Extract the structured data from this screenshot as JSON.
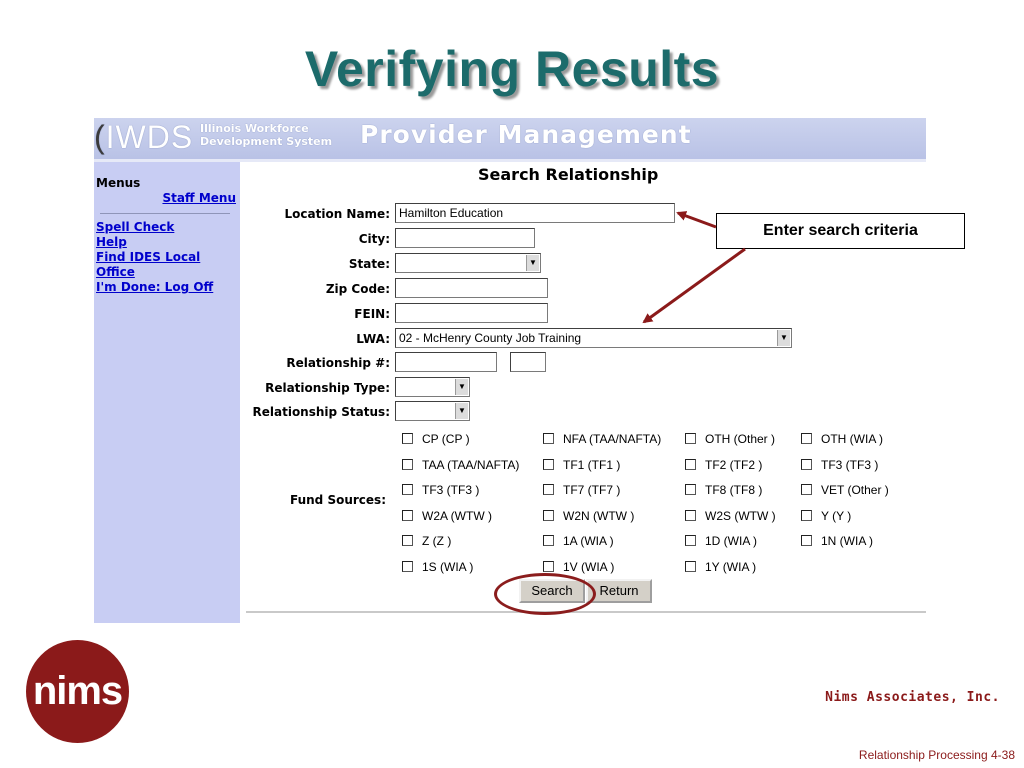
{
  "slide": {
    "title": "Verifying Results",
    "callout": "Enter search criteria",
    "company": "Nims Associates, Inc.",
    "footer": "Relationship Processing  4-38",
    "logo_text": "nims",
    "accent_color": "#8b1a1a",
    "title_color": "#1c6b6b"
  },
  "app": {
    "logo": "IWDS",
    "subtitle_line1": "Illinois Workforce",
    "subtitle_line2": "Development System",
    "product": "Provider Management",
    "banner_color": "#c0c8ea",
    "sidebar_color": "#c8cdf3"
  },
  "sidebar": {
    "menus_label": "Menus",
    "staff_menu": "Staff Menu",
    "links": [
      "Spell Check",
      "Help",
      "Find IDES Local",
      "Office",
      "I'm Done: Log Off"
    ]
  },
  "form": {
    "title": "Search Relationship",
    "location_name": {
      "label": "Location Name:",
      "value": "Hamilton Education"
    },
    "city": {
      "label": "City:",
      "value": ""
    },
    "state": {
      "label": "State:",
      "value": ""
    },
    "zip": {
      "label": "Zip Code:",
      "value": ""
    },
    "fein": {
      "label": "FEIN:",
      "value": ""
    },
    "lwa": {
      "label": "LWA:",
      "value": "02 - McHenry County Job Training"
    },
    "relationship_num": {
      "label": "Relationship #:",
      "value": ""
    },
    "relationship_type": {
      "label": "Relationship Type:",
      "value": ""
    },
    "relationship_status": {
      "label": "Relationship Status:",
      "value": ""
    },
    "fund_sources_label": "Fund Sources:",
    "fund_sources": [
      [
        "CP (CP )",
        "NFA (TAA/NAFTA)",
        "OTH (Other )",
        "OTH (WIA )"
      ],
      [
        "TAA (TAA/NAFTA)",
        "TF1 (TF1 )",
        "TF2 (TF2 )",
        "TF3 (TF3 )"
      ],
      [
        "TF3 (TF3 )",
        "TF7 (TF7 )",
        "TF8 (TF8 )",
        "VET (Other )"
      ],
      [
        "W2A (WTW )",
        "W2N (WTW )",
        "W2S (WTW )",
        "Y (Y )"
      ],
      [
        "Z (Z )",
        "1A (WIA )",
        "1D (WIA )",
        "1N (WIA )"
      ],
      [
        "1S (WIA )",
        "1V (WIA )",
        "1Y (WIA )",
        ""
      ]
    ],
    "search_button": "Search",
    "return_button": "Return"
  }
}
